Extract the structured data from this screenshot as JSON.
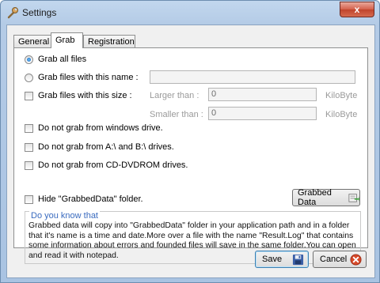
{
  "window": {
    "title": "Settings",
    "close_glyph": "x"
  },
  "tabs": [
    {
      "label": "General"
    },
    {
      "label": "Grab"
    },
    {
      "label": "Registration"
    }
  ],
  "grab": {
    "option_all": "Grab all files",
    "option_name": "Grab files with this name :",
    "option_size": "Grab files with this size :",
    "larger_label": "Larger than :",
    "larger_value": "0",
    "smaller_label": "Smaller than :",
    "smaller_value": "0",
    "unit_1": "KiloByte",
    "unit_2": "KiloByte",
    "no_windows": "Do not grab from windows drive.",
    "no_ab": "Do not grab from A:\\ and B:\\ drives.",
    "no_cd": "Do not grab from CD-DVDROM drives.",
    "hide_folder": "Hide \"GrabbedData\" folder.",
    "grabbed_button": "Grabbed Data"
  },
  "info": {
    "title": "Do you know that",
    "text": "Grabbed data will copy into \"GrabbedData\" folder in your application path and in a folder that it's name is a time and date.More over a file with the name \"Result.Log\" that contains some information about errors and founded files will save in the same folder.You can open and read it with notepad."
  },
  "footer": {
    "save": "Save",
    "cancel": "Cancel"
  }
}
